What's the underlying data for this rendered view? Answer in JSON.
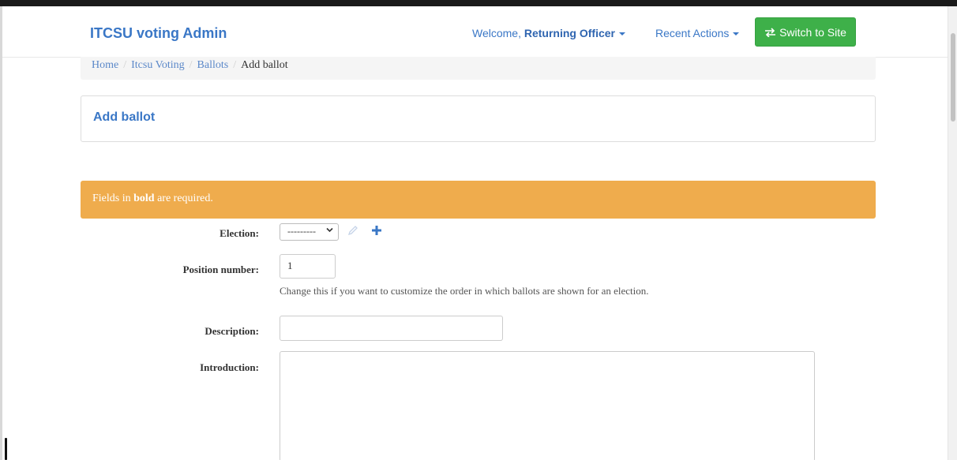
{
  "navbar": {
    "brand": "ITCSU voting Admin",
    "welcome_prefix": "Welcome,",
    "user_name": "Returning Officer",
    "recent_actions": "Recent Actions",
    "switch_button": "Switch to Site"
  },
  "breadcrumb": {
    "items": [
      "Home",
      "Itcsu Voting",
      "Ballots"
    ],
    "separator": "/",
    "active": "Add ballot"
  },
  "page": {
    "title": "Add ballot"
  },
  "alert": {
    "prefix": "Fields in",
    "bold_word": "bold",
    "suffix": "are required."
  },
  "form": {
    "election": {
      "label": "Election:",
      "selected": "---------"
    },
    "position_number": {
      "label": "Position number:",
      "value": "1",
      "help": "Change this if you want to customize the order in which ballots are shown for an election."
    },
    "description": {
      "label": "Description:",
      "value": ""
    },
    "introduction": {
      "label": "Introduction:",
      "value": ""
    }
  },
  "colors": {
    "brand_blue": "#3a77c6",
    "success_green": "#3eb049",
    "warning_orange": "#efac4d"
  },
  "icons": {
    "switch": "swap-arrows-icon",
    "edit": "pencil-icon",
    "add": "plus-icon"
  }
}
